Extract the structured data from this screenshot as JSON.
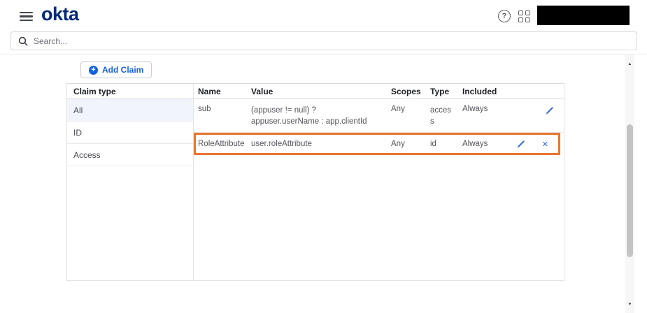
{
  "topbar": {
    "logo_text": "okta"
  },
  "search": {
    "placeholder": "Search..."
  },
  "content": {
    "add_claim_button": "Add Claim",
    "claim_type_panel": {
      "header": "Claim type",
      "items": [
        {
          "label": "All",
          "selected": true
        },
        {
          "label": "ID",
          "selected": false
        },
        {
          "label": "Access",
          "selected": false
        }
      ]
    },
    "claims_table": {
      "columns": [
        "Name",
        "Value",
        "Scopes",
        "Type",
        "Included"
      ],
      "rows": [
        {
          "name": "sub",
          "value": "(appuser != null) ? appuser.userName : app.clientId",
          "scopes": "Any",
          "type": "access",
          "included": "Always",
          "highlighted": false
        },
        {
          "name": "RoleAttribute",
          "value": "user.roleAttribute",
          "scopes": "Any",
          "type": "id",
          "included": "Always",
          "highlighted": true
        }
      ]
    }
  },
  "icons": {
    "help": "?",
    "plus": "+",
    "close": "✕",
    "scroll_up": "▲",
    "scroll_down": "▼"
  },
  "colors": {
    "brand_navy": "#00297a",
    "accent_blue": "#1662dd",
    "icon_blue": "#2b65dd",
    "highlight_orange": "#e8772e",
    "selected_item_bg": "#f1f4fb"
  }
}
